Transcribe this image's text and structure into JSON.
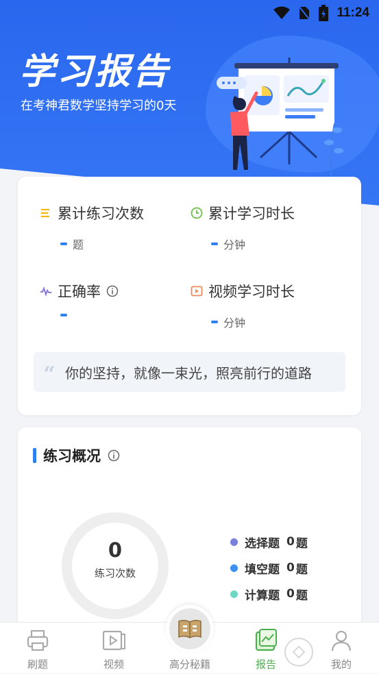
{
  "status": {
    "time": "11:24"
  },
  "hero": {
    "title": "学习报告",
    "subtitle": "在考神君数学坚持学习的0天"
  },
  "stats": {
    "items": [
      {
        "icon": "list-icon",
        "label": "累计练习次数",
        "value": "-",
        "unit": "题"
      },
      {
        "icon": "clock-icon",
        "label": "累计学习时长",
        "value": "-",
        "unit": "分钟"
      },
      {
        "icon": "pulse-icon",
        "label": "正确率",
        "value": "-",
        "unit": ""
      },
      {
        "icon": "video-icon",
        "label": "视频学习时长",
        "value": "-",
        "unit": "分钟"
      }
    ],
    "quote": "你的坚持，就像一束光，照亮前行的道路"
  },
  "practice": {
    "title": "练习概况",
    "total": "0",
    "total_label": "练习次数",
    "legend": [
      {
        "name": "选择题",
        "count": "0",
        "unit": "题",
        "color": "#7b7fdc"
      },
      {
        "name": "填空题",
        "count": "0",
        "unit": "题",
        "color": "#3d8ff0"
      },
      {
        "name": "计算题",
        "count": "0",
        "unit": "题",
        "color": "#6fd8c4"
      }
    ]
  },
  "tabs": [
    {
      "label": "刷题",
      "icon": "printer-icon"
    },
    {
      "label": "视频",
      "icon": "video-play-icon"
    },
    {
      "label": "高分秘籍",
      "icon": "book-icon"
    },
    {
      "label": "报告",
      "icon": "report-chart-icon",
      "active": true
    },
    {
      "label": "我的",
      "icon": "user-icon"
    }
  ],
  "colors": {
    "primary": "#2a67ee",
    "accent": "#2f80ed",
    "active_tab": "#4caf50"
  }
}
